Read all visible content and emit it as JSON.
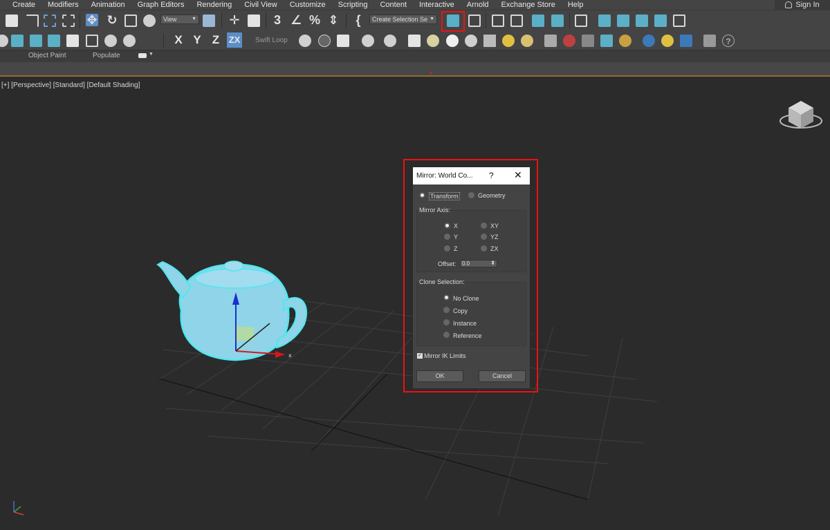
{
  "menu": {
    "items": [
      "Create",
      "Modifiers",
      "Animation",
      "Graph Editors",
      "Rendering",
      "Civil View",
      "Customize",
      "Scripting",
      "Content",
      "Interactive",
      "Arnold",
      "Exchange Store",
      "Help"
    ],
    "sign_in": "Sign In"
  },
  "toolbar": {
    "view_dropdown": "View",
    "selection_set": "Create Selection Se",
    "axis_x": "X",
    "axis_y": "Y",
    "axis_z": "Z",
    "axis_zx": "ZX",
    "swift_loop": "Swift Loop"
  },
  "ribbon": {
    "object_paint": "Object Paint",
    "populate": "Populate"
  },
  "viewport": {
    "label": "[+] [Perspective] [Standard] [Default Shading]",
    "gizmo_x_label": "x"
  },
  "dialog": {
    "title": "Mirror: World Co...",
    "help_glyph": "?",
    "close_glyph": "✕",
    "mode_transform": "Transform",
    "mode_geometry": "Geometry",
    "mirror_axis_label": "Mirror Axis:",
    "axes": [
      "X",
      "Y",
      "Z",
      "XY",
      "YZ",
      "ZX"
    ],
    "selected_axis": "X",
    "offset_label": "Offset:",
    "offset_value": "0.0",
    "clone_label": "Clone Selection:",
    "clone_options": [
      "No Clone",
      "Copy",
      "Instance",
      "Reference"
    ],
    "selected_clone": "No Clone",
    "mirror_ik_limits": "Mirror IK Limits",
    "mirror_ik_checked": true,
    "ok": "OK",
    "cancel": "Cancel"
  },
  "colors": {
    "highlight": "#e11111",
    "teapot": "#8fd4e8",
    "selection_outline": "#4ee8f0"
  }
}
